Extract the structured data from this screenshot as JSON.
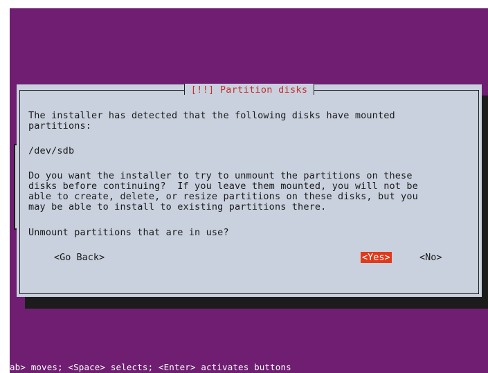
{
  "dialog": {
    "title": "[!!] Partition disks",
    "intro_line1": "The installer has detected that the following disks have mounted",
    "intro_line2": "partitions:",
    "disk": "/dev/sdb",
    "question_line1": "Do you want the installer to try to unmount the partitions on these",
    "question_line2": "disks before continuing?  If you leave them mounted, you will not be",
    "question_line3": "able to create, delete, or resize partitions on these disks, but you",
    "question_line4": "may be able to install to existing partitions there.",
    "prompt": "Unmount partitions that are in use?",
    "buttons": {
      "go_back": "<Go Back>",
      "yes": "<Yes>",
      "no": "<No>"
    }
  },
  "hint_bar": "ab> moves; <Space> selects; <Enter> activates buttons",
  "colors": {
    "background": "#6f1e72",
    "dialog": "#c9d1de",
    "title": "#c2322f",
    "active_button": "#e13a1b"
  }
}
